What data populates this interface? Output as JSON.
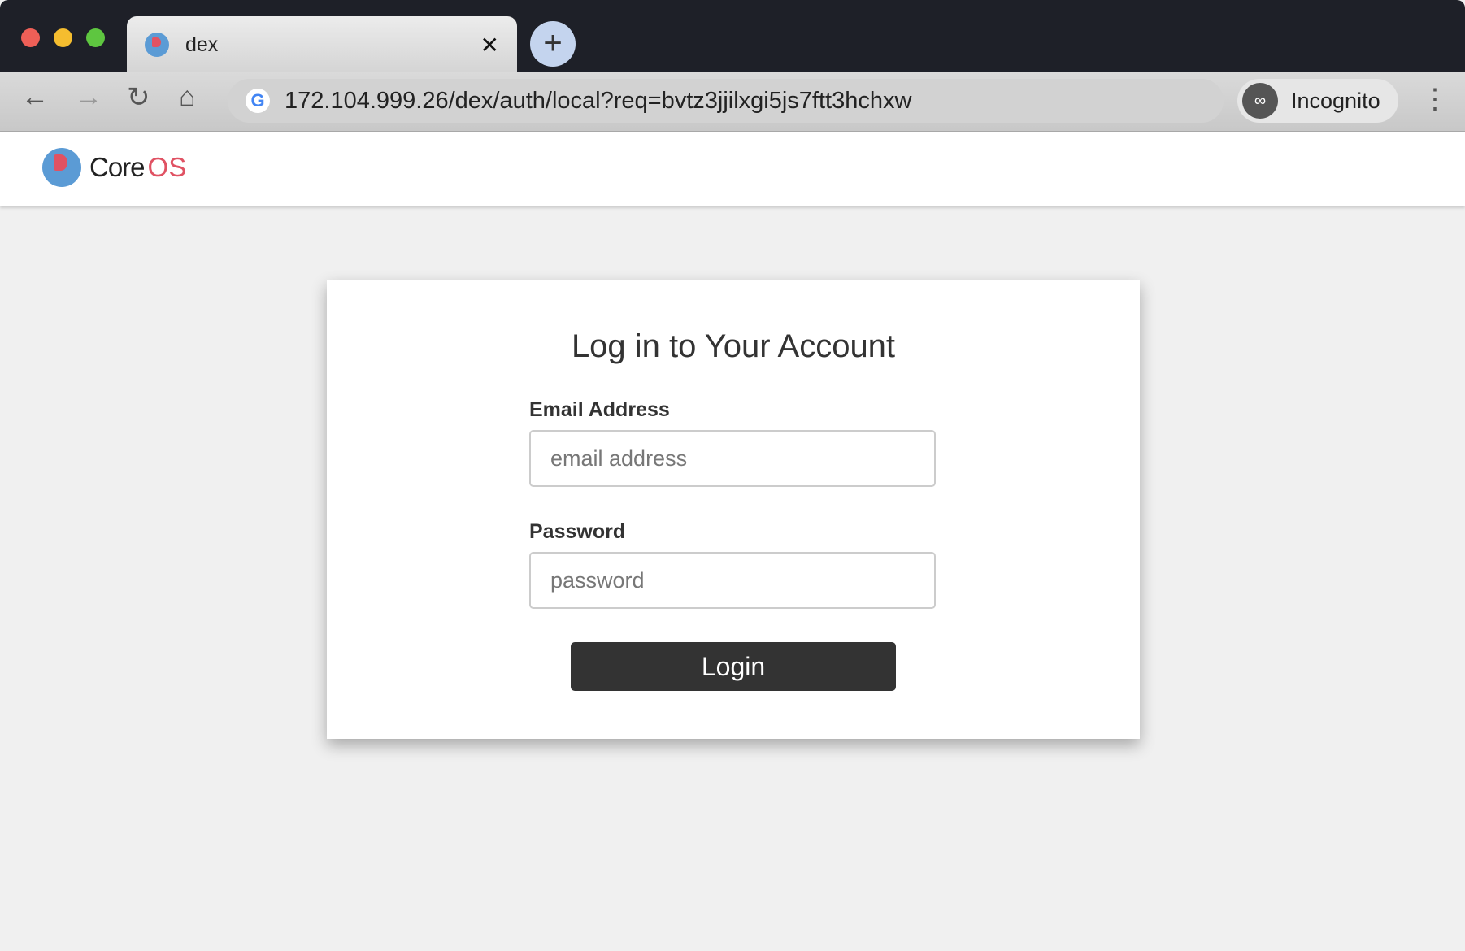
{
  "browser": {
    "tab": {
      "title": "dex"
    },
    "url": "172.104.999.26/dex/auth/local?req=bvtz3jjilxgi5js7ftt3hchxw",
    "incognito_label": "Incognito",
    "colors": {
      "close": "#ee5f57",
      "minimize": "#f5bd2f",
      "zoom": "#5ec640"
    }
  },
  "header": {
    "logo_core": "Core",
    "logo_os": "OS"
  },
  "login": {
    "title": "Log in to Your Account",
    "email_label": "Email Address",
    "email_placeholder": "email address",
    "email_value": "",
    "password_label": "Password",
    "password_placeholder": "password",
    "password_value": "",
    "button": "Login"
  }
}
